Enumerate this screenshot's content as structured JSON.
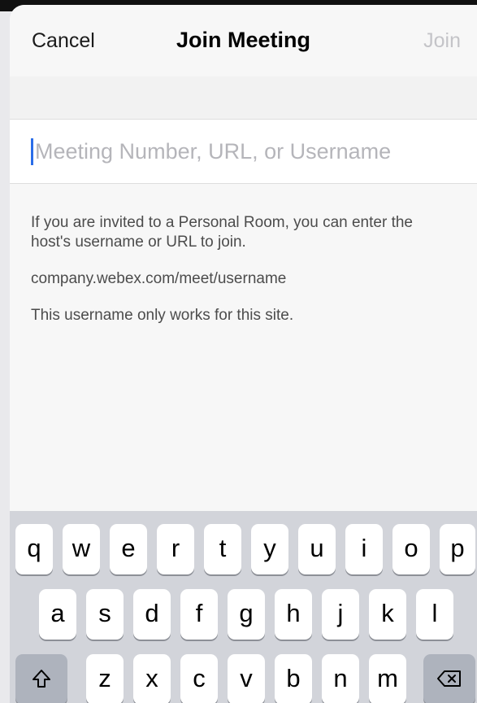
{
  "navbar": {
    "cancel_label": "Cancel",
    "title": "Join Meeting",
    "join_label": "Join"
  },
  "meeting_input": {
    "value": "",
    "placeholder": "Meeting Number, URL, or Username"
  },
  "help": {
    "line1": "If you are invited to a Personal Room, you can enter the host's username or URL to join.",
    "line2": "company.webex.com/meet/username",
    "line3": "This username only works for this site."
  },
  "keyboard": {
    "row1": [
      "q",
      "w",
      "e",
      "r",
      "t",
      "y",
      "u",
      "i",
      "o",
      "p"
    ],
    "row2": [
      "a",
      "s",
      "d",
      "f",
      "g",
      "h",
      "j",
      "k",
      "l"
    ],
    "row3": [
      "z",
      "x",
      "c",
      "v",
      "b",
      "n",
      "m"
    ],
    "shift_icon": "shift-icon",
    "delete_icon": "backspace-icon"
  },
  "colors": {
    "caret": "#2a6de8",
    "join_disabled": "#c4c4c8",
    "keyboard_bg": "#d2d4da",
    "special_key": "#aeb3bd"
  }
}
